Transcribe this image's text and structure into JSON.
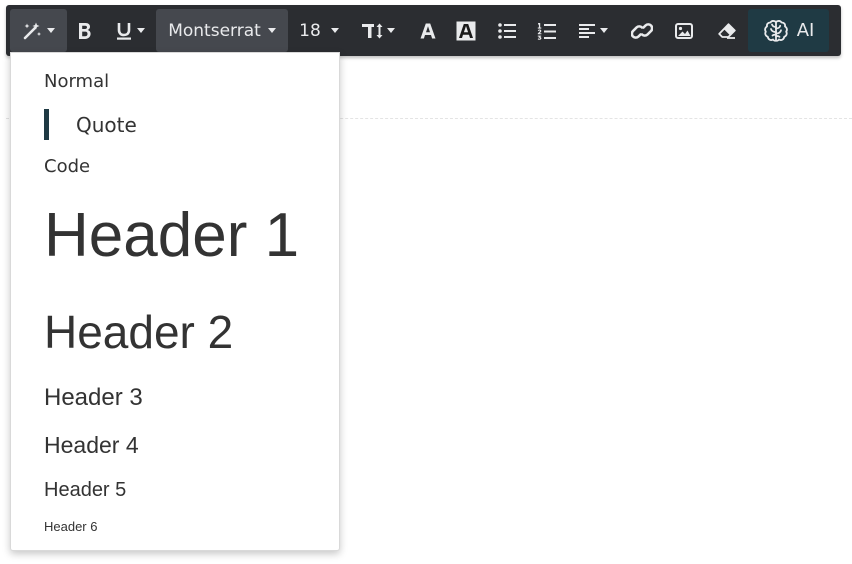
{
  "colors": {
    "toolbar_bg": "#2b2d31",
    "toolbar_active": "#45484e",
    "toolbar_fg": "#e9eaec",
    "ai_bg": "#1f3a44",
    "quote_bar": "#1f3a44",
    "text": "#333333"
  },
  "toolbar": {
    "buttons": [
      {
        "name": "magic-wand-style",
        "icon": "magic-wand-icon",
        "has_caret": true,
        "active": true
      },
      {
        "name": "bold",
        "icon": "bold-icon"
      },
      {
        "name": "underline",
        "icon": "underline-icon",
        "has_caret": true
      },
      {
        "name": "font-family",
        "icon": "none",
        "has_caret": true,
        "active": true
      },
      {
        "name": "font-size",
        "icon": "none",
        "has_caret": true
      },
      {
        "name": "line-height",
        "icon": "line-height-icon",
        "has_caret": true
      },
      {
        "name": "font-color",
        "icon": "font-color-icon"
      },
      {
        "name": "highlight-color",
        "icon": "highlight-icon"
      },
      {
        "name": "bulleted-list",
        "icon": "list-ul-icon"
      },
      {
        "name": "numbered-list",
        "icon": "list-ol-icon"
      },
      {
        "name": "align",
        "icon": "align-left-icon",
        "has_caret": true
      },
      {
        "name": "link",
        "icon": "link-icon"
      },
      {
        "name": "image",
        "icon": "image-icon"
      },
      {
        "name": "clear-format",
        "icon": "eraser-icon"
      },
      {
        "name": "ai",
        "icon": "brain-icon"
      }
    ],
    "font_family": "Montserrat",
    "font_size": "18",
    "ai_label": "AI"
  },
  "style_menu": {
    "items": [
      {
        "label": "Normal"
      },
      {
        "label": "Quote"
      },
      {
        "label": "Code"
      },
      {
        "label": "Header 1"
      },
      {
        "label": "Header 2"
      },
      {
        "label": "Header 3"
      },
      {
        "label": "Header 4"
      },
      {
        "label": "Header 5"
      },
      {
        "label": "Header 6"
      }
    ]
  }
}
